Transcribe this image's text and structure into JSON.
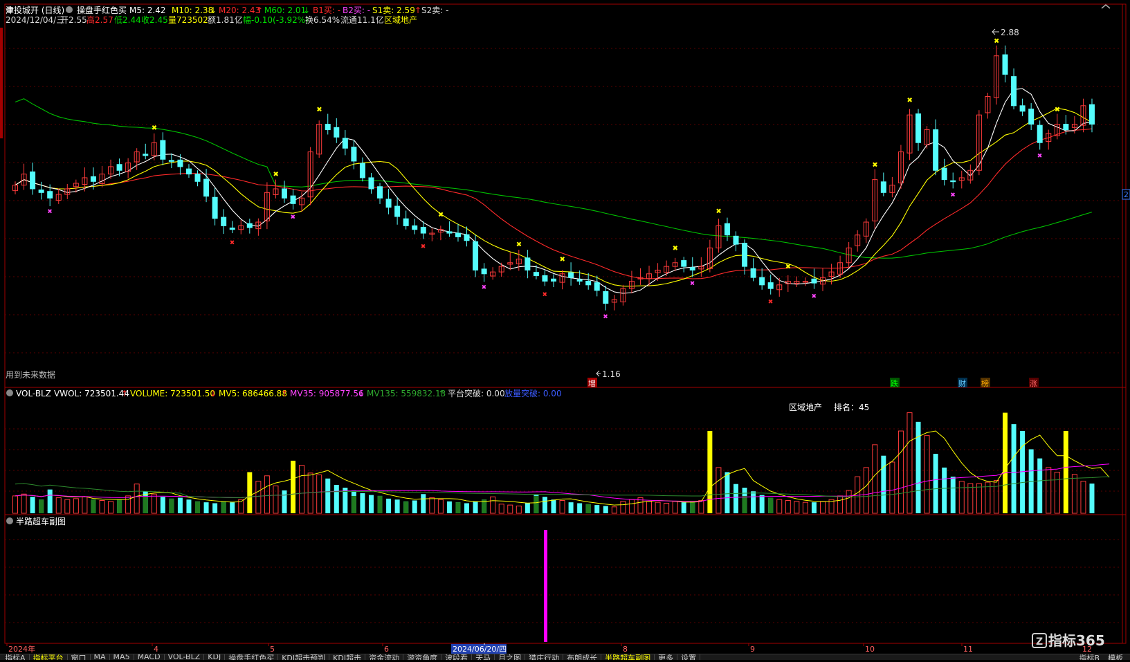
{
  "header": {
    "stock_name": "津投城开 (日线)",
    "indicator_name": "操盘手红色买",
    "m5": "M5: 2.42",
    "m10": "M10: 2.38",
    "m20": "M20: 2.43",
    "m60": "M60: 2.01",
    "b1": "B1买: -",
    "b2": "B2买: -",
    "s1": "S1卖: 2.59",
    "s2": "S2卖: -",
    "date": "2024/12/04/三",
    "open": "开2.55",
    "high": "高2.57",
    "low": "低2.44",
    "close": "收2.45",
    "volume": "量723502",
    "amount": "额1.81亿",
    "change": "幅-0.10(-3.92%)",
    "turnover": "换6.54%",
    "float": "流通11.1亿",
    "sector": "区域地产"
  },
  "price_panel": {
    "future_data_note": "用到未来数据",
    "high_mark": "2.88",
    "low_mark": "1.16",
    "event_tags": [
      "增",
      "跌",
      "财",
      "榜",
      "涨"
    ],
    "right_price_tag": "2"
  },
  "volume_panel": {
    "title": "VOL-BLZ",
    "vwol": "VWOL: 723501.44",
    "volume": "VOLUME: 723501.50",
    "mv5": "MV5: 686466.88",
    "mv35": "MV35: 905877.56",
    "mv135": "MV135: 559832.13",
    "platform": "平台突破: 0.00",
    "breakout": "放量突破: 0.00",
    "sector_label": "区域地产",
    "rank_label": "排名：45"
  },
  "sub_panel": {
    "title": "半路超车副图"
  },
  "time_axis": {
    "labels": [
      "2024年",
      "4",
      "5",
      "6",
      "8",
      "9",
      "10",
      "11",
      "12"
    ],
    "cursor_date": "2024/06/20/四"
  },
  "bottom_tabs": [
    "指标A",
    "指标平台",
    "窗口",
    "MA",
    "MA5",
    "MACD",
    "VOL-BLZ",
    "KDJ",
    "操盘手红色买",
    "KDJ超击预判",
    "KDJ超击",
    "资金流动",
    "游资角度",
    "波段看",
    "天马",
    "月之图",
    "猎庄行动",
    "布朗成长",
    "半路超车副图",
    "更多",
    "设置"
  ],
  "bottom_right": [
    "指标B",
    "模板"
  ],
  "watermark": "指标365",
  "colors": {
    "up": "#ff3b3b",
    "down": "#54fcfc",
    "ma5": "#ffffff",
    "ma10": "#ffff00",
    "ma20": "#ff2a2a",
    "ma60": "#00c000",
    "mv35": "#ff00ff",
    "mv135": "#2e8b2e",
    "highlight_vol": "#ffff00",
    "magenta_bar": "#ff00ff"
  },
  "chart_data": [
    {
      "type": "candlestick",
      "title": "",
      "x": [
        "2024-01",
        "2024-04",
        "2024-05",
        "2024-06",
        "2024-08",
        "2024-09",
        "2024-10",
        "2024-11",
        "2024-12"
      ],
      "ylim": [
        1.1,
        2.95
      ],
      "overlays": [
        "MA5",
        "MA10",
        "MA20",
        "MA60"
      ],
      "close": [
        2.12,
        2.18,
        2.1,
        2.08,
        2.05,
        2.07,
        2.1,
        2.13,
        2.16,
        2.14,
        2.18,
        2.22,
        2.2,
        2.24,
        2.3,
        2.28,
        2.35,
        2.26,
        2.25,
        2.22,
        2.18,
        2.14,
        2.06,
        1.94,
        1.9,
        1.88,
        1.9,
        1.89,
        1.92,
        2.08,
        2.1,
        2.05,
        2.02,
        2.05,
        2.3,
        2.45,
        2.42,
        2.38,
        2.32,
        2.25,
        2.16,
        2.1,
        2.05,
        2.0,
        1.95,
        1.9,
        1.88,
        1.86,
        1.86,
        1.88,
        1.86,
        1.84,
        1.82,
        1.66,
        1.64,
        1.65,
        1.68,
        1.7,
        1.72,
        1.66,
        1.63,
        1.6,
        1.6,
        1.64,
        1.62,
        1.6,
        1.58,
        1.55,
        1.48,
        1.5,
        1.56,
        1.6,
        1.62,
        1.64,
        1.66,
        1.68,
        1.7,
        1.68,
        1.66,
        1.68,
        1.78,
        1.9,
        1.85,
        1.8,
        1.68,
        1.62,
        1.58,
        1.56,
        1.58,
        1.6,
        1.6,
        1.6,
        1.59,
        1.62,
        1.65,
        1.7,
        1.78,
        1.85,
        1.92,
        2.15,
        2.08,
        2.12,
        2.3,
        2.5,
        2.35,
        2.42,
        2.2,
        2.15,
        2.14,
        2.16,
        2.2,
        2.5,
        2.6,
        2.82,
        2.72,
        2.55,
        2.52,
        2.45,
        2.35,
        2.4,
        2.45,
        2.42,
        2.45,
        2.55,
        2.45
      ],
      "special_marks": {
        "high": 2.88,
        "low": 1.16
      }
    },
    {
      "type": "bar",
      "title": "VOL-BLZ",
      "series": [
        {
          "name": "VOLUME",
          "values": [
            380000,
            420000,
            360000,
            300000,
            520000,
            340000,
            300000,
            320000,
            360000,
            300000,
            280000,
            260000,
            300000,
            380000,
            640000,
            480000,
            420000,
            360000,
            320000,
            340000,
            300000,
            260000,
            240000,
            220000,
            260000,
            240000,
            300000,
            900000,
            700000,
            820000,
            600000,
            500000,
            1150000,
            1050000,
            880000,
            840000,
            760000,
            620000,
            560000,
            500000,
            440000,
            400000,
            380000,
            320000,
            300000,
            260000,
            280000,
            420000,
            340000,
            300000,
            260000,
            240000,
            220000,
            260000,
            300000,
            360000,
            200000,
            180000,
            160000,
            220000,
            400000,
            360000,
            300000,
            280000,
            240000,
            220000,
            200000,
            180000,
            160000,
            140000,
            260000,
            300000,
            340000,
            260000,
            240000,
            220000,
            260000,
            240000,
            260000,
            280000,
            1800000,
            1000000,
            900000,
            640000,
            560000,
            480000,
            400000,
            340000,
            300000,
            280000,
            260000,
            240000,
            240000,
            260000,
            300000,
            380000,
            500000,
            800000,
            1000000,
            1500000,
            1260000,
            1120000,
            1800000,
            2200000,
            2000000,
            1700000,
            1300000,
            1000000,
            800000,
            700000,
            650000,
            650000,
            680000,
            720000,
            2200000,
            1950000,
            1800000,
            1400000,
            1200000,
            1000000,
            900000,
            1800000,
            850000,
            700000,
            650000,
            1000000,
            723502
          ]
        },
        {
          "name": "MV5",
          "values": [
            686466.88
          ]
        },
        {
          "name": "MV35",
          "values": [
            905877.56
          ]
        },
        {
          "name": "MV135",
          "values": [
            559832.13
          ]
        }
      ]
    },
    {
      "type": "bar",
      "title": "半路超车副图",
      "series": [
        {
          "name": "",
          "values": [
            1
          ]
        }
      ]
    }
  ]
}
